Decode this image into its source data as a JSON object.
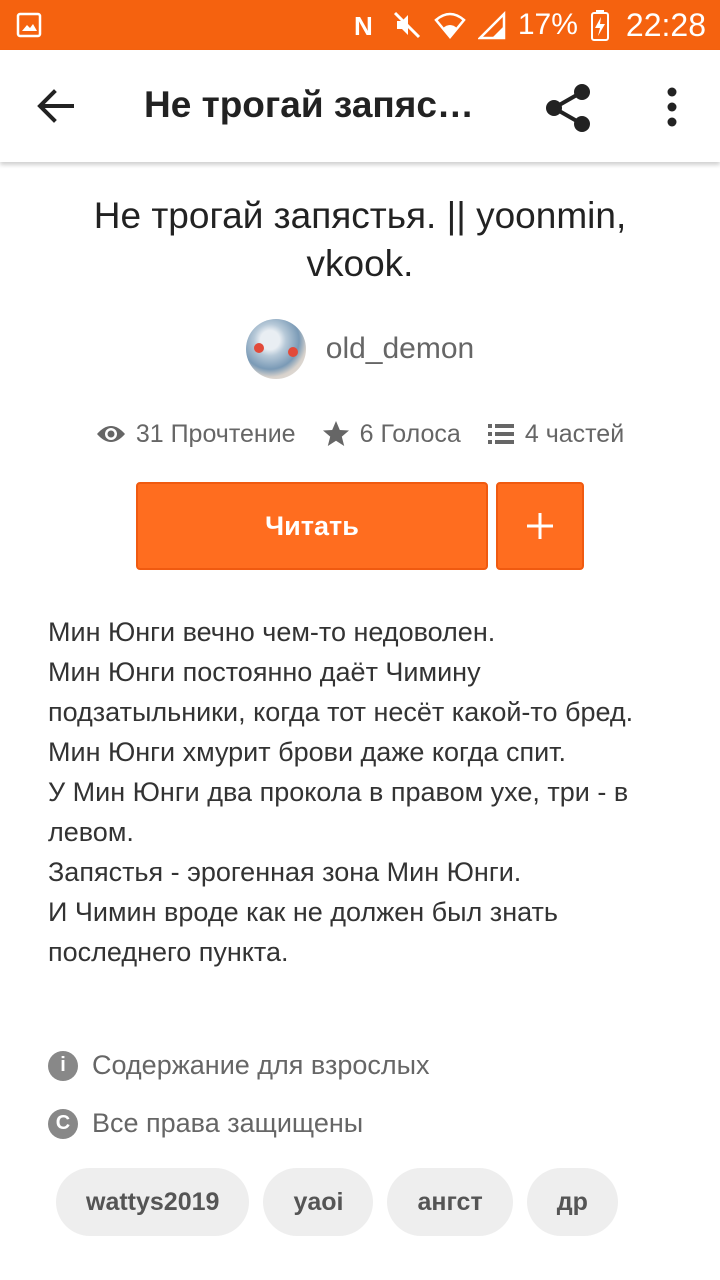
{
  "status_bar": {
    "battery": "17%",
    "time": "22:28"
  },
  "app_bar": {
    "title": "Не трогай запяс…"
  },
  "story": {
    "title": "Не трогай запястья. || yoonmin, vkook.",
    "author": "old_demon",
    "stats": {
      "reads": "31 Прочтение",
      "votes": "6 Голоса",
      "parts": "4 частей"
    },
    "read_label": "Читать",
    "add_label": "+",
    "description": [
      "Мин Юнги вечно чем-то недоволен.",
      "Мин Юнги постоянно даёт Чимину подзатыльники, когда тот несёт какой-то бред.",
      "Мин Юнги хмурит брови даже когда спит.",
      "У Мин Юнги два прокола в правом ухе, три - в левом.",
      "Запястья - эрогенная зона Мин Юнги.",
      "И Чимин вроде как не должен был знать последнего пункта."
    ],
    "mature_label": "Содержание для взрослых",
    "copyright_label": "Все права защищены",
    "tags": [
      "wattys2019",
      "yaoi",
      "ангст",
      "др"
    ]
  },
  "colors": {
    "accent": "#ff6d1f",
    "status_bar": "#f5620f"
  },
  "icons": {
    "back": "arrow-left-icon",
    "share": "share-icon",
    "more": "more-vert-icon",
    "reads": "eye-icon",
    "votes": "star-icon",
    "parts": "list-icon",
    "mature": "info-icon",
    "copyright": "copyright-icon"
  }
}
